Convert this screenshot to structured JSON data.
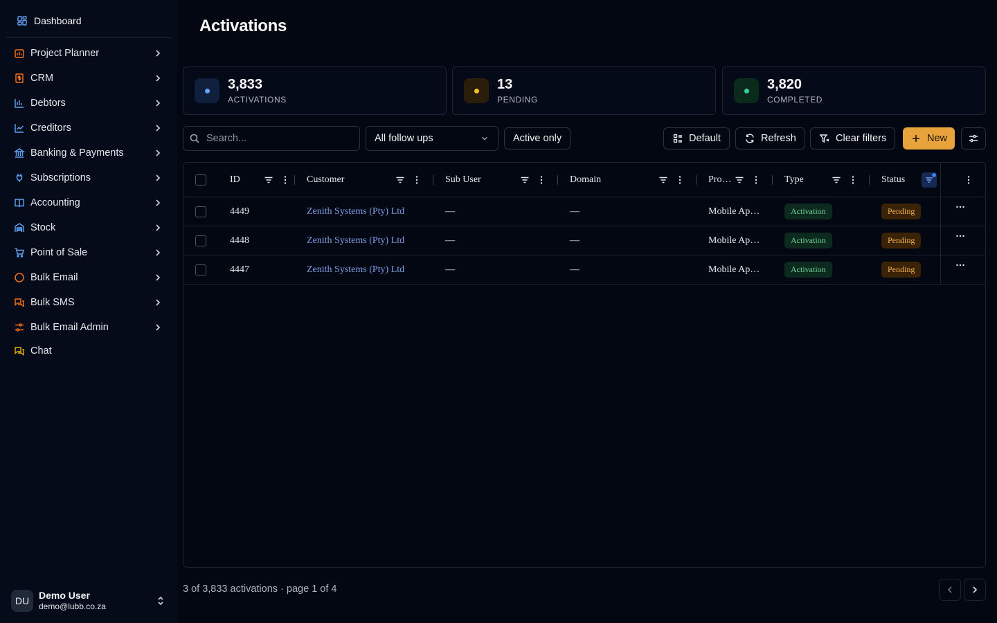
{
  "sidebar": {
    "dashboard_label": "Dashboard",
    "items": [
      {
        "label": "Project Planner",
        "icon": "calendar-chart-icon",
        "color": "#f97316"
      },
      {
        "label": "CRM",
        "icon": "dollar-receipt-icon",
        "color": "#f97316"
      },
      {
        "label": "Debtors",
        "icon": "bar-chart-icon",
        "color": "#60a5fa"
      },
      {
        "label": "Creditors",
        "icon": "line-chart-icon",
        "color": "#60a5fa"
      },
      {
        "label": "Banking & Payments",
        "icon": "bank-icon",
        "color": "#60a5fa"
      },
      {
        "label": "Subscriptions",
        "icon": "plug-icon",
        "color": "#60a5fa"
      },
      {
        "label": "Accounting",
        "icon": "book-icon",
        "color": "#60a5fa"
      },
      {
        "label": "Stock",
        "icon": "warehouse-icon",
        "color": "#60a5fa"
      },
      {
        "label": "Point of Sale",
        "icon": "cart-icon",
        "color": "#60a5fa"
      },
      {
        "label": "Bulk Email",
        "icon": "circle-icon",
        "color": "#f97316"
      },
      {
        "label": "Bulk SMS",
        "icon": "messages-icon",
        "color": "#f97316"
      },
      {
        "label": "Bulk Email Admin",
        "icon": "sliders-icon",
        "color": "#f97316"
      }
    ],
    "chat_label": "Chat",
    "user": {
      "initials": "DU",
      "name": "Demo User",
      "email": "demo@lubb.co.za"
    }
  },
  "page": {
    "title": "Activations"
  },
  "stats": [
    {
      "value": "3,833",
      "label": "ACTIVATIONS",
      "dot_color": "#60a5fa",
      "bg": "#10203c"
    },
    {
      "value": "13",
      "label": "PENDING",
      "dot_color": "#fbbf24",
      "bg": "#2a1d0a"
    },
    {
      "value": "3,820",
      "label": "COMPLETED",
      "dot_color": "#34d399",
      "bg": "#0a2a1c"
    }
  ],
  "toolbar": {
    "search_placeholder": "Search...",
    "followup_select": "All follow ups",
    "active_only": "Active only",
    "default_label": "Default",
    "refresh_label": "Refresh",
    "clear_filters_label": "Clear filters",
    "new_label": "New",
    "accent": "#e8a33d"
  },
  "table": {
    "columns": [
      "ID",
      "Customer",
      "Sub User",
      "Domain",
      "Pro…",
      "Type",
      "Status"
    ],
    "rows": [
      {
        "id": "4449",
        "customer": "Zenith Systems (Pty) Ltd",
        "sub_user": "—",
        "domain": "—",
        "product": "Mobile Ap…",
        "type": "Activation",
        "status": "Pending"
      },
      {
        "id": "4448",
        "customer": "Zenith Systems (Pty) Ltd",
        "sub_user": "—",
        "domain": "—",
        "product": "Mobile Ap…",
        "type": "Activation",
        "status": "Pending"
      },
      {
        "id": "4447",
        "customer": "Zenith Systems (Pty) Ltd",
        "sub_user": "—",
        "domain": "—",
        "product": "Mobile Ap…",
        "type": "Activation",
        "status": "Pending"
      }
    ]
  },
  "footer": {
    "summary": "3 of 3,833 activations · page 1 of 4"
  }
}
